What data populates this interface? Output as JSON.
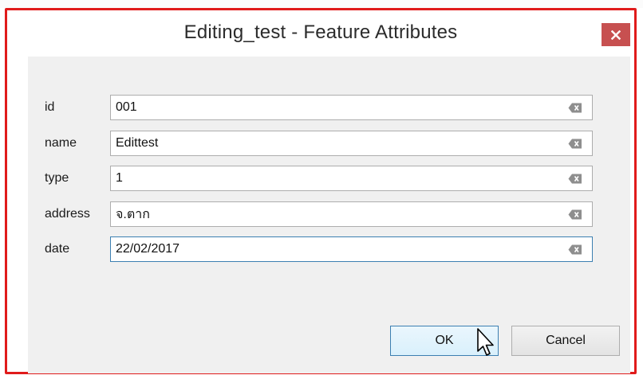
{
  "dialog": {
    "title": "Editing_test - Feature Attributes",
    "close_icon": "close-icon"
  },
  "fields": [
    {
      "label": "id",
      "value": "001"
    },
    {
      "label": "name",
      "value": "Edittest"
    },
    {
      "label": "type",
      "value": "1"
    },
    {
      "label": "address",
      "value": "จ.ตาก"
    },
    {
      "label": "date",
      "value": "22/02/2017"
    }
  ],
  "buttons": {
    "ok_label": "OK",
    "cancel_label": "Cancel"
  },
  "colors": {
    "highlight_border": "#e01b1b",
    "close_button": "#c75050",
    "focus_border": "#3c7fb1",
    "client_background": "#f0f0f0"
  }
}
